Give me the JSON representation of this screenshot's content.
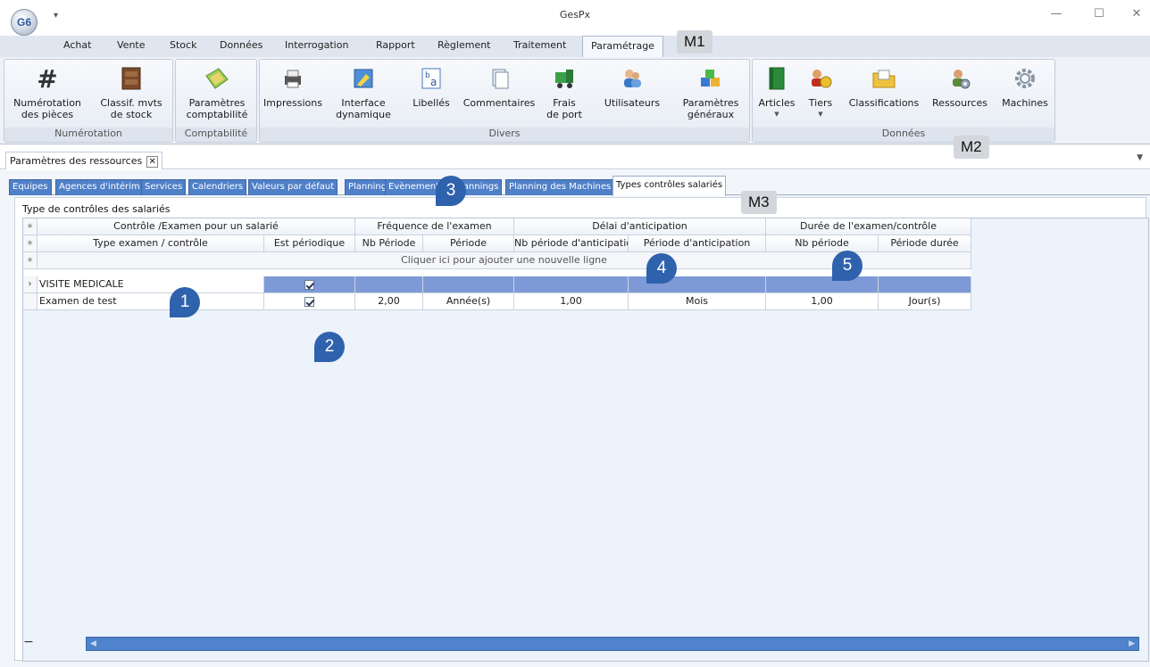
{
  "window": {
    "title": "GesPx",
    "orb_label": "G6",
    "controls": [
      "—",
      "☐",
      "✕"
    ]
  },
  "ribbon_tabs": [
    "Achat",
    "Vente",
    "Stock",
    "Données",
    "Interrogation",
    "Rapport",
    "Règlement",
    "Traitement",
    "Paramétrage"
  ],
  "active_ribbon_tab": "Paramétrage",
  "ribbon": {
    "groups": {
      "numerotation": "Numérotation",
      "comptabilite": "Comptabilité",
      "divers": "Divers",
      "donnees": "Données"
    },
    "buttons": {
      "numerotation_pieces": "Numérotation\ndes pièces",
      "classif_mvts": "Classif. mvts\nde stock",
      "parametres_comptabilite": "Paramètres\ncomptabilité",
      "impressions": "Impressions",
      "interface_dynamique": "Interface\ndynamique",
      "libelles": "Libellés",
      "commentaires": "Commentaires",
      "frais_de_port": "Frais\nde port",
      "utilisateurs": "Utilisateurs",
      "parametres_generaux": "Paramètres\ngénéraux",
      "articles": "Articles",
      "tiers": "Tiers",
      "classifications": "Classifications",
      "ressources": "Ressources",
      "machines": "Machines"
    }
  },
  "document_tab": "Paramètres des ressources",
  "sub_tabs": [
    "Equipes",
    "Agences d'intérim",
    "Services",
    "Calendriers",
    "Valeurs par défaut",
    "Planning",
    "Evènements",
    "Plannings",
    "Planning des Machines",
    "Types contrôles salariés"
  ],
  "section_title": "Type de contrôles des salariés",
  "grid": {
    "bands": [
      "Contrôle /Examen pour un salarié",
      "Fréquence de l'examen",
      "Délai d'anticipation",
      "Durée de l'examen/contrôle"
    ],
    "columns": [
      "Type examen / contrôle",
      "Est périodique",
      "Nb Période",
      "Période",
      "Nb période d'anticipation",
      "Période d'anticipation",
      "Nb période",
      "Période durée"
    ],
    "new_row_hint": "Cliquer ici pour ajouter une nouvelle ligne",
    "rows": [
      {
        "type": "VISITE MEDICALE",
        "periodique": true,
        "nb_periode": "",
        "periode": "",
        "nb_anticipation": "",
        "periode_anticipation": "",
        "nb_duree": "",
        "periode_duree": ""
      },
      {
        "type": "Examen de test",
        "periodique": true,
        "nb_periode": "2,00",
        "periode": "Année(s)",
        "nb_anticipation": "1,00",
        "periode_anticipation": "Mois",
        "nb_duree": "1,00",
        "periode_duree": "Jour(s)"
      }
    ]
  },
  "annotations": {
    "m1": "M1",
    "m2": "M2",
    "m3": "M3",
    "n1": "1",
    "n2": "2",
    "n3": "3",
    "n4": "4",
    "n5": "5"
  },
  "colors": {
    "selected_row": "#7e9ad6",
    "subtab_blue": "#4f80c8",
    "callout": "#2f62ad"
  }
}
